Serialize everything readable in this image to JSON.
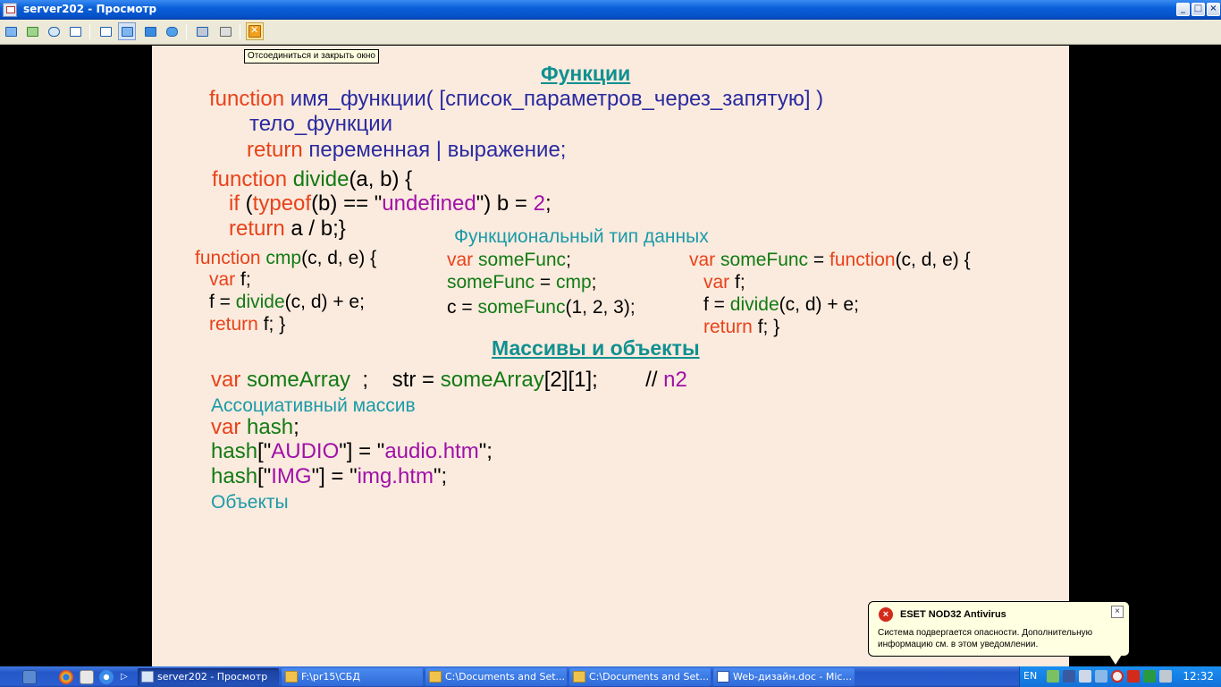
{
  "window": {
    "title": "server202 - Просмотр"
  },
  "toolbar": {
    "tooltip": "Отсоединиться и закрыть окно"
  },
  "slide": {
    "heading_functions": "Функции",
    "syntax": {
      "kw_function": "function",
      "signature": " имя_функции( [список_параметров_через_запятую] )",
      "body": "тело_функции",
      "kw_return": "return",
      "return_value": " переменная | выражение;"
    },
    "divide": {
      "l1_kw": "function",
      "l1_name": " divide",
      "l1_rest": "(a, b) {",
      "l2_if": "if",
      "l2_open": " (",
      "l2_typeof": "typeof",
      "l2_b": "(b) == \"",
      "l2_str": "undefined",
      "l2_assign": "\") b = ",
      "l2_num": "2",
      "l2_end": ";",
      "l3_kw": "return",
      "l3_rest": " a / b;}"
    },
    "functional_type": "Функциональный тип данных",
    "cmp": {
      "l1_kw": "function",
      "l1_name": " cmp",
      "l1_rest": "(c, d, e) {",
      "l2_kw": "var",
      "l2_rest": " f;",
      "l3_a": "f = ",
      "l3_fn": "divide",
      "l3_b": "(c, d) + e;",
      "l4_kw": "return",
      "l4_rest": " f; }"
    },
    "mid": {
      "l1_kw": "var",
      "l1_name": " someFunc",
      "l1_end": ";",
      "l2_name": "someFunc",
      "l2_eq": " = ",
      "l2_cmp": "cmp",
      "l2_end": ";",
      "l3_a": "c = ",
      "l3_fn": "someFunc",
      "l3_args": "(1, 2, 3);"
    },
    "right": {
      "l1_kw": "var",
      "l1_name": " someFunc",
      "l1_eq": " = ",
      "l1_fn": "function",
      "l1_args": "(c, d, e) {",
      "l2_kw": "var",
      "l2_rest": " f;",
      "l3_a": "f = ",
      "l3_fn": "divide",
      "l3_b": "(c, d) + e;",
      "l4_kw": "return",
      "l4_rest": " f; }"
    },
    "heading_arrays": "Массивы и объекты",
    "arr": {
      "l1_kw": "var",
      "l1_name": " someArray",
      "l1_semi": "  ;    str = ",
      "l1_ref": "someArray",
      "l1_idx": "[2][1];        // ",
      "l1_note": "n2",
      "assoc": "Ассоциативный массив",
      "l2_kw": "var",
      "l2_name": " hash",
      "l2_end": ";",
      "l3_h": "hash",
      "l3_a": "[\"",
      "l3_key": "AUDIO",
      "l3_b": "\"] = \"",
      "l3_val": "audio.htm",
      "l3_c": "\";",
      "l4_h": "hash",
      "l4_a": "[\"",
      "l4_key": "IMG",
      "l4_b": "\"] = \"",
      "l4_val": "img.htm",
      "l4_c": "\";",
      "objects": "Объекты"
    }
  },
  "taskbar": {
    "tasks": [
      {
        "label": "server202 - Просмотр"
      },
      {
        "label": "F:\\pr15\\СБД"
      },
      {
        "label": "C:\\Documents and Set..."
      },
      {
        "label": "C:\\Documents and Set..."
      },
      {
        "label": "Web-дизайн.doc - Mic..."
      }
    ],
    "lang": "EN",
    "clock": "12:32"
  },
  "balloon": {
    "title": "ESET NOD32 Antivirus",
    "message": "Система подвергается опасности. Дополнительную информацию см. в этом уведомлении."
  },
  "colors": {
    "keyword": "#e8421a",
    "identifier": "#127a14",
    "string": "#a010a8",
    "heading": "#109090",
    "slide_bg": "#fbebde"
  }
}
